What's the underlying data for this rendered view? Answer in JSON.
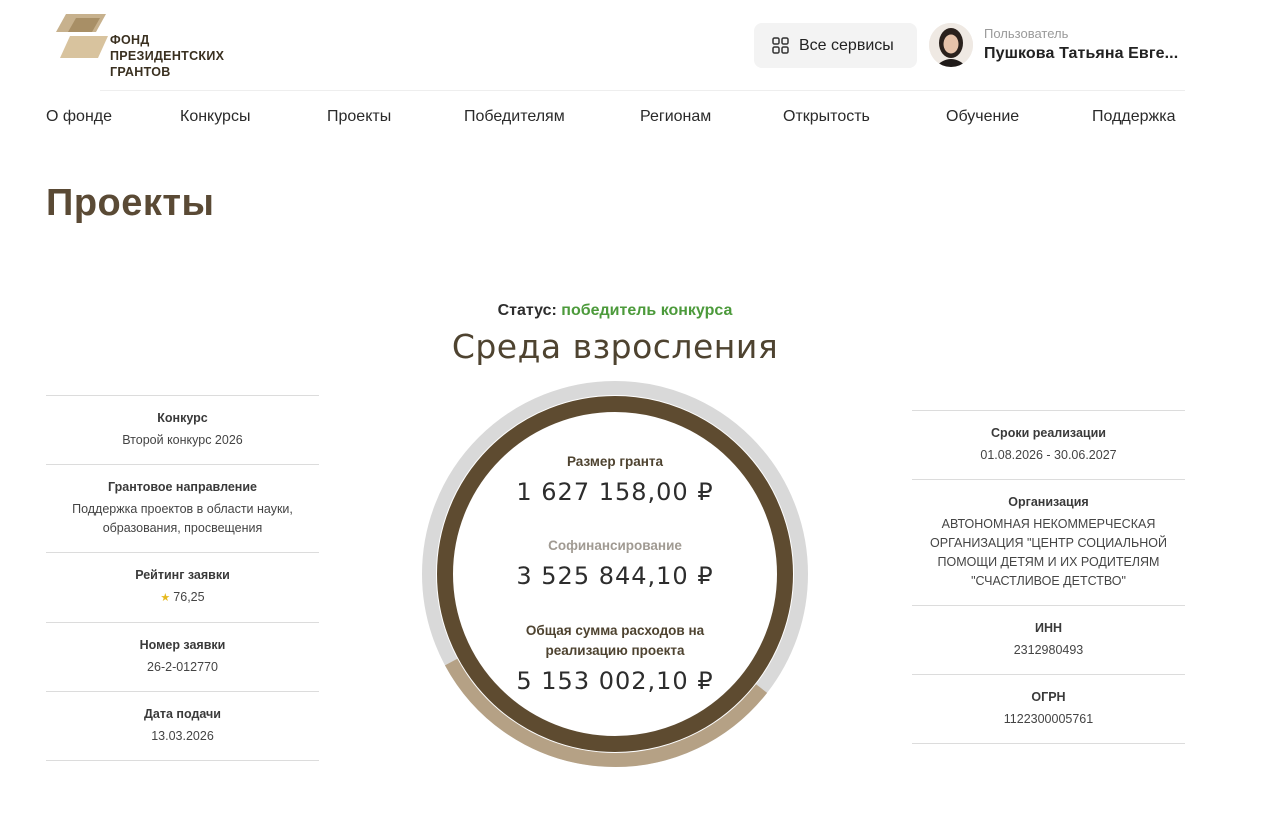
{
  "header": {
    "logo_lines": [
      "ФОНД",
      "ПРЕЗИДЕНТСКИХ",
      "ГРАНТОВ"
    ],
    "services_label": "Все сервисы",
    "user_role": "Пользователь",
    "user_name": "Пушкова Татьяна Евге..."
  },
  "nav": [
    "О фонде",
    "Конкурсы",
    "Проекты",
    "Победителям",
    "Регионам",
    "Открытость",
    "Обучение",
    "Поддержка"
  ],
  "page_title": "Проекты",
  "status": {
    "label": "Статус:",
    "value": "победитель конкурса"
  },
  "project_name": "Среда взросления",
  "left": [
    {
      "label": "Конкурс",
      "value": "Второй конкурс 2026"
    },
    {
      "label": "Грантовое направление",
      "value": "Поддержка проектов в области науки, образования, просвещения"
    },
    {
      "label": "Рейтинг заявки",
      "value": "76,25"
    },
    {
      "label": "Номер заявки",
      "value": "26-2-012770"
    },
    {
      "label": "Дата подачи",
      "value": "13.03.2026"
    }
  ],
  "right": [
    {
      "label": "Сроки реализации",
      "value": "01.08.2026 - 30.06.2027"
    },
    {
      "label": "Организация",
      "value": "АВТОНОМНАЯ НЕКОММЕРЧЕСКАЯ ОРГАНИЗАЦИЯ \"ЦЕНТР СОЦИАЛЬНОЙ ПОМОЩИ ДЕТЯМ И ИХ РОДИТЕЛЯМ \"СЧАСТЛИВОЕ ДЕТСТВО\""
    },
    {
      "label": "ИНН",
      "value": "2312980493"
    },
    {
      "label": "ОГРН",
      "value": "1122300005761"
    }
  ],
  "finance": {
    "grant_label": "Размер гранта",
    "grant_value": "1 627 158,00 ₽",
    "cofin_label": "Софинансирование",
    "cofin_value": "3 525 844,10 ₽",
    "total_label": "Общая сумма расходов на реализацию проекта",
    "total_value": "5 153 002,10 ₽",
    "grant_share": 0.316
  },
  "colors": {
    "brand_dark": "#5e4b30",
    "brand_light": "#b5a185",
    "ring_grey": "#d9d9d9",
    "status_green": "#4c9a3b"
  },
  "icons": {
    "logo": "fpg-logo-icon",
    "services": "grid-icon",
    "rating": "star-icon"
  }
}
